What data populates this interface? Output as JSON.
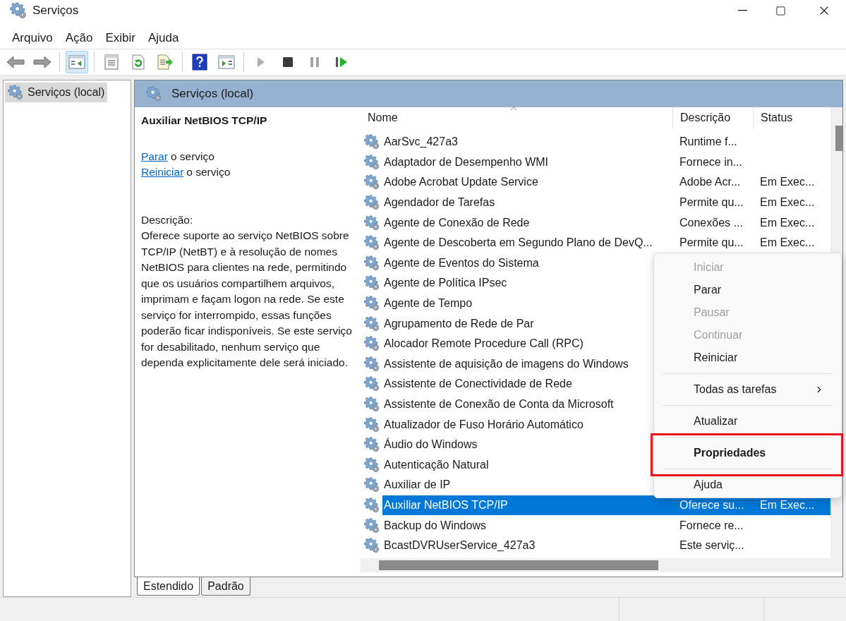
{
  "window": {
    "title": "Serviços"
  },
  "menu_bar": [
    "Arquivo",
    "Ação",
    "Exibir",
    "Ajuda"
  ],
  "toolbar": [
    {
      "kind": "back",
      "disabled": false,
      "selected": false
    },
    {
      "kind": "forward",
      "disabled": false,
      "selected": false
    },
    {
      "kind": "separator"
    },
    {
      "kind": "tree",
      "disabled": false,
      "selected": true
    },
    {
      "kind": "separator"
    },
    {
      "kind": "properties",
      "disabled": false,
      "selected": false
    },
    {
      "kind": "refresh",
      "disabled": false,
      "selected": false
    },
    {
      "kind": "export",
      "disabled": false,
      "selected": false
    },
    {
      "kind": "separator"
    },
    {
      "kind": "help",
      "disabled": false,
      "selected": false
    },
    {
      "kind": "pane",
      "disabled": false,
      "selected": false
    },
    {
      "kind": "separator"
    },
    {
      "kind": "play",
      "disabled": true,
      "selected": false
    },
    {
      "kind": "stop",
      "disabled": false,
      "selected": false
    },
    {
      "kind": "pause",
      "disabled": true,
      "selected": false
    },
    {
      "kind": "resume",
      "disabled": false,
      "selected": false
    }
  ],
  "tree": {
    "items": [
      {
        "label": "Serviços (local)",
        "selected": true
      }
    ]
  },
  "pane_header": "Serviços (local)",
  "details": {
    "title": "Auxiliar NetBIOS TCP/IP",
    "actions": [
      {
        "link": "Parar",
        "rest": "o serviço"
      },
      {
        "link": "Reiniciar",
        "rest": "o serviço"
      }
    ],
    "description_label": "Descrição:",
    "description": "Oferece suporte ao serviço NetBIOS sobre TCP/IP (NetBT) e à resolução de nomes NetBIOS para clientes na rede, permitindo que os usuários compartilhem arquivos, imprimam e façam logon na rede. Se este serviço for interrompido, essas funções poderão ficar indisponíveis. Se este serviço for desabilitado, nenhum serviço que dependa explicitamente dele será iniciado."
  },
  "table": {
    "columns": [
      "Nome",
      "Descrição",
      "Status"
    ],
    "rows": [
      {
        "name": "AarSvc_427a3",
        "description": "Runtime f...",
        "selected": false
      },
      {
        "name": "Adaptador de Desempenho WMI",
        "description": "Fornece in...",
        "selected": false
      },
      {
        "name": "Adobe Acrobat Update Service",
        "description": "Adobe Acr...",
        "status": "Em Exec...",
        "selected": false
      },
      {
        "name": "Agendador de Tarefas",
        "description": "Permite qu...",
        "status": "Em Exec...",
        "selected": false
      },
      {
        "name": "Agente de Conexão de Rede",
        "description": "Conexões ...",
        "status": "Em Exec...",
        "selected": false
      },
      {
        "name": "Agente de Descoberta em Segundo Plano de DevQ...",
        "description": "Permite qu...",
        "status": "Em Exec...",
        "selected": false
      },
      {
        "name": "Agente de Eventos do Sistema",
        "selected": false
      },
      {
        "name": "Agente de Política IPsec",
        "selected": false
      },
      {
        "name": "Agente de Tempo",
        "selected": false
      },
      {
        "name": "Agrupamento de Rede de Par",
        "selected": false
      },
      {
        "name": "Alocador Remote Procedure Call (RPC)",
        "selected": false
      },
      {
        "name": "Assistente de aquisição de imagens do Windows",
        "selected": false
      },
      {
        "name": "Assistente de Conectividade de Rede",
        "selected": false
      },
      {
        "name": "Assistente de Conexão de Conta da Microsoft",
        "selected": false
      },
      {
        "name": "Atualizador de Fuso Horário Automático",
        "selected": false
      },
      {
        "name": "Áudio do Windows",
        "selected": false
      },
      {
        "name": "Autenticação Natural",
        "selected": false
      },
      {
        "name": "Auxiliar de IP",
        "selected": false
      },
      {
        "name": "Auxiliar NetBIOS TCP/IP",
        "description": "Oferece su...",
        "status": "Em Exec...",
        "selected": true
      },
      {
        "name": "Backup do Windows",
        "description": "Fornece re...",
        "selected": false
      },
      {
        "name": "BcastDVRUserService_427a3",
        "description": "Este serviç...",
        "selected": false
      }
    ]
  },
  "view_tabs": [
    {
      "label": "Estendido",
      "selected": true
    },
    {
      "label": "Padrão",
      "selected": false
    }
  ],
  "context_menu": [
    {
      "kind": "item",
      "label": "Iniciar",
      "disabled": true
    },
    {
      "kind": "item",
      "label": "Parar",
      "disabled": false
    },
    {
      "kind": "item",
      "label": "Pausar",
      "disabled": true
    },
    {
      "kind": "item",
      "label": "Continuar",
      "disabled": true
    },
    {
      "kind": "item",
      "label": "Reiniciar",
      "disabled": false
    },
    {
      "kind": "separator"
    },
    {
      "kind": "submenu",
      "label": "Todas as tarefas",
      "disabled": false
    },
    {
      "kind": "separator"
    },
    {
      "kind": "item",
      "label": "Atualizar",
      "disabled": false
    },
    {
      "kind": "separator"
    },
    {
      "kind": "item",
      "label": "Propriedades",
      "disabled": false,
      "bold": true,
      "annotated": true
    },
    {
      "kind": "separator"
    },
    {
      "kind": "item",
      "label": "Ajuda",
      "disabled": false
    }
  ]
}
